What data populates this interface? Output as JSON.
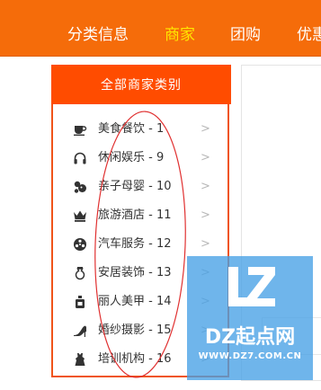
{
  "nav": {
    "items": [
      {
        "label": "分类信息",
        "active": false
      },
      {
        "label": "商家",
        "active": true
      },
      {
        "label": "团购",
        "active": false
      },
      {
        "label": "优惠",
        "active": false
      }
    ],
    "background": "#f56c0a",
    "active_color": "#ffe600"
  },
  "category_panel": {
    "title": "全部商家类别",
    "accent": "#ff4c00",
    "items": [
      {
        "label": "美食餐饮 - 1",
        "icon": "coffee-cup-icon"
      },
      {
        "label": "休闲娱乐 - 9",
        "icon": "headphones-icon"
      },
      {
        "label": "亲子母婴 - 10",
        "icon": "baby-toy-icon"
      },
      {
        "label": "旅游酒店 - 11",
        "icon": "crown-icon"
      },
      {
        "label": "汽车服务 - 12",
        "icon": "wheel-icon"
      },
      {
        "label": "安居装饰 - 13",
        "icon": "vase-icon"
      },
      {
        "label": "丽人美甲 - 14",
        "icon": "perfume-icon"
      },
      {
        "label": "婚纱摄影 - 15",
        "icon": "high-heel-icon"
      },
      {
        "label": "培训机构 - 16",
        "icon": "dress-icon"
      }
    ],
    "arrow": ">"
  },
  "watermark": {
    "name": "DZ起点网",
    "url": "WWW.DZ7.COM.CN",
    "color": "#46a0e6"
  },
  "annotation": {
    "color": "#e03030"
  }
}
